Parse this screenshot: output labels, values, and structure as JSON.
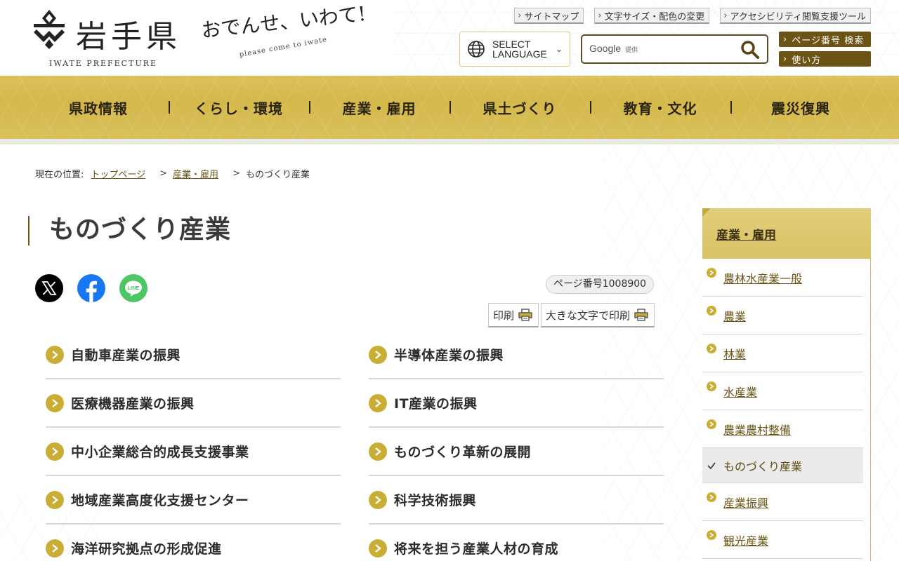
{
  "header": {
    "logo_text": "岩手県",
    "logo_sub": "IWATE PREFECTURE",
    "tagline": "おでんせ、いわて!",
    "tagline_sub": "please come to iwate",
    "util_links": [
      "サイトマップ",
      "文字サイズ・配色の変更",
      "アクセシビリティ閲覧支援ツール"
    ],
    "language_select": {
      "line1": "SELECT",
      "line2": "LANGUAGE"
    },
    "search": {
      "google_label": "Google",
      "provided_label": "提供",
      "placeholder": ""
    },
    "page_search_label": "ページ番号 検索",
    "usage_label": "使い方"
  },
  "nav": {
    "items": [
      "県政情報",
      "くらし・環境",
      "産業・雇用",
      "県土づくり",
      "教育・文化",
      "震災復興"
    ]
  },
  "breadcrumb": {
    "prefix": "現在の位置:",
    "items": [
      "トップページ",
      "産業・雇用",
      "ものづくり産業"
    ]
  },
  "page": {
    "title": "ものづくり産業",
    "page_number": "ページ番号1008900",
    "print_label": "印刷",
    "large_print_label": "大きな文字で印刷"
  },
  "share": [
    "X",
    "Facebook",
    "LINE"
  ],
  "links": {
    "left": [
      "自動車産業の振興",
      "医療機器産業の振興",
      "中小企業総合的成長支援事業",
      "地域産業高度化支援センター",
      "海洋研究拠点の形成促進"
    ],
    "right": [
      "半導体産業の振興",
      "IT産業の振興",
      "ものづくり革新の展開",
      "科学技術振興",
      "将来を担う産業人材の育成"
    ]
  },
  "sidebar": {
    "heading": "産業・雇用",
    "items": [
      "農林水産業一般",
      "農業",
      "林業",
      "水産業",
      "農業農村整備",
      "ものづくり産業",
      "産業振興",
      "観光産業"
    ],
    "current_index": 5
  },
  "colors": {
    "gold": "#c9ad35",
    "nav_gold": "#d4b84a",
    "brown": "#6b5416"
  }
}
